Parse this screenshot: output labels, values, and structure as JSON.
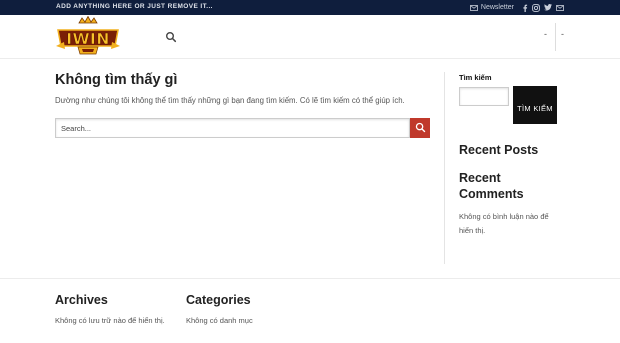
{
  "topbar": {
    "text": "ADD ANYTHING HERE OR JUST REMOVE IT...",
    "newsletter_label": "Newsletter",
    "icons": [
      "mail-icon",
      "facebook-icon",
      "instagram-icon",
      "twitter-icon",
      "mail-icon"
    ]
  },
  "header": {
    "logo_alt": "IWIN",
    "right_items": [
      "-",
      "-"
    ]
  },
  "main": {
    "title": "Không tìm thấy gì",
    "description": "Dường như chúng tôi không thể tìm thấy những gì bạn đang tìm kiếm. Có lẽ tìm kiếm có thể giúp ích.",
    "search_placeholder": "Search..."
  },
  "sidebar": {
    "search_label": "Tìm kiếm",
    "search_button": "TÌM KIẾM",
    "recent_posts_title": "Recent Posts",
    "recent_comments_title": "Recent Comments",
    "no_comments": "Không có bình luận nào để hiển thị."
  },
  "footer": {
    "archives_title": "Archives",
    "archives_text": "Không có lưu trữ nào để hiển thị.",
    "categories_title": "Categories",
    "categories_text": "Không có danh mục"
  },
  "colors": {
    "topbar_bg": "#0f1e3d",
    "search_accent": "#c0392b",
    "sidebar_button": "#111111"
  }
}
